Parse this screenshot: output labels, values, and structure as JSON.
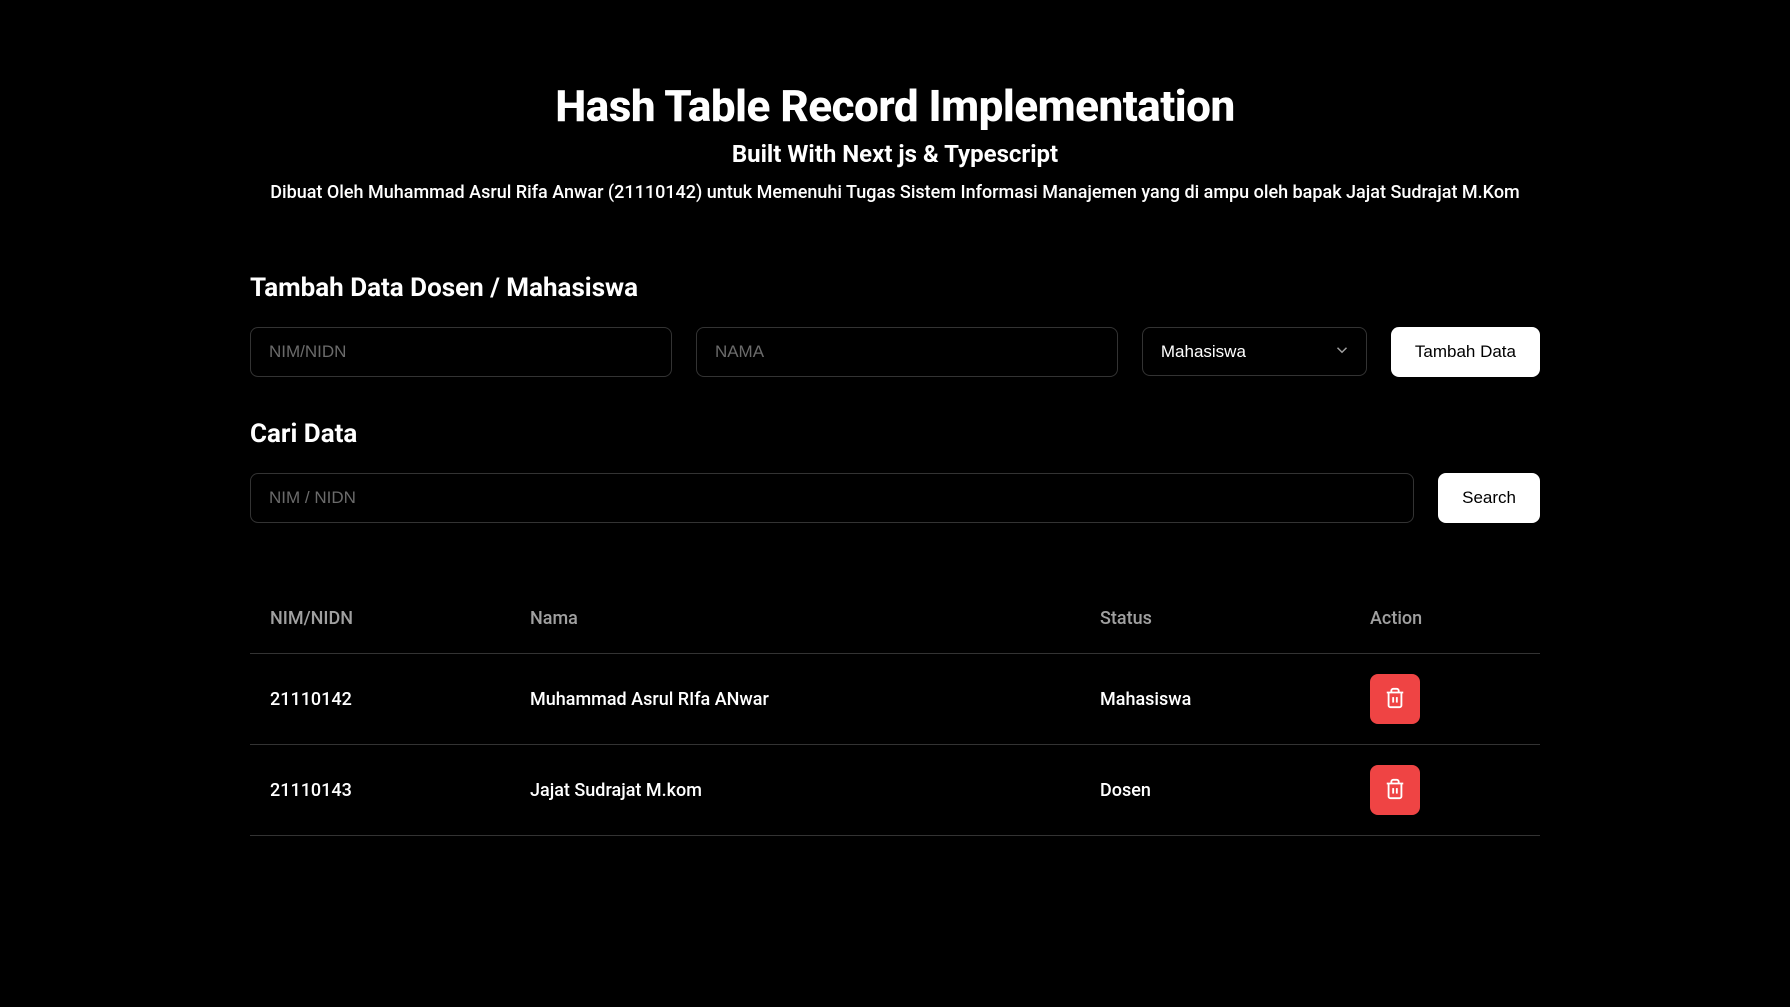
{
  "header": {
    "title": "Hash Table Record Implementation",
    "subtitle": "Built With Next js & Typescript",
    "description": "Dibuat Oleh Muhammad Asrul Rifa Anwar (21110142) untuk Memenuhi Tugas Sistem Informasi Manajemen yang di ampu oleh bapak Jajat Sudrajat M.Kom"
  },
  "addForm": {
    "title": "Tambah Data Dosen / Mahasiswa",
    "nimPlaceholder": "NIM/NIDN",
    "namaPlaceholder": "NAMA",
    "selectValue": "Mahasiswa",
    "buttonLabel": "Tambah Data"
  },
  "searchForm": {
    "title": "Cari Data",
    "placeholder": "NIM / NIDN",
    "buttonLabel": "Search"
  },
  "table": {
    "headers": {
      "nim": "NIM/NIDN",
      "nama": "Nama",
      "status": "Status",
      "action": "Action"
    },
    "rows": [
      {
        "nim": "21110142",
        "nama": "Muhammad Asrul RIfa ANwar",
        "status": "Mahasiswa"
      },
      {
        "nim": "21110143",
        "nama": "Jajat Sudrajat M.kom",
        "status": "Dosen"
      }
    ]
  }
}
